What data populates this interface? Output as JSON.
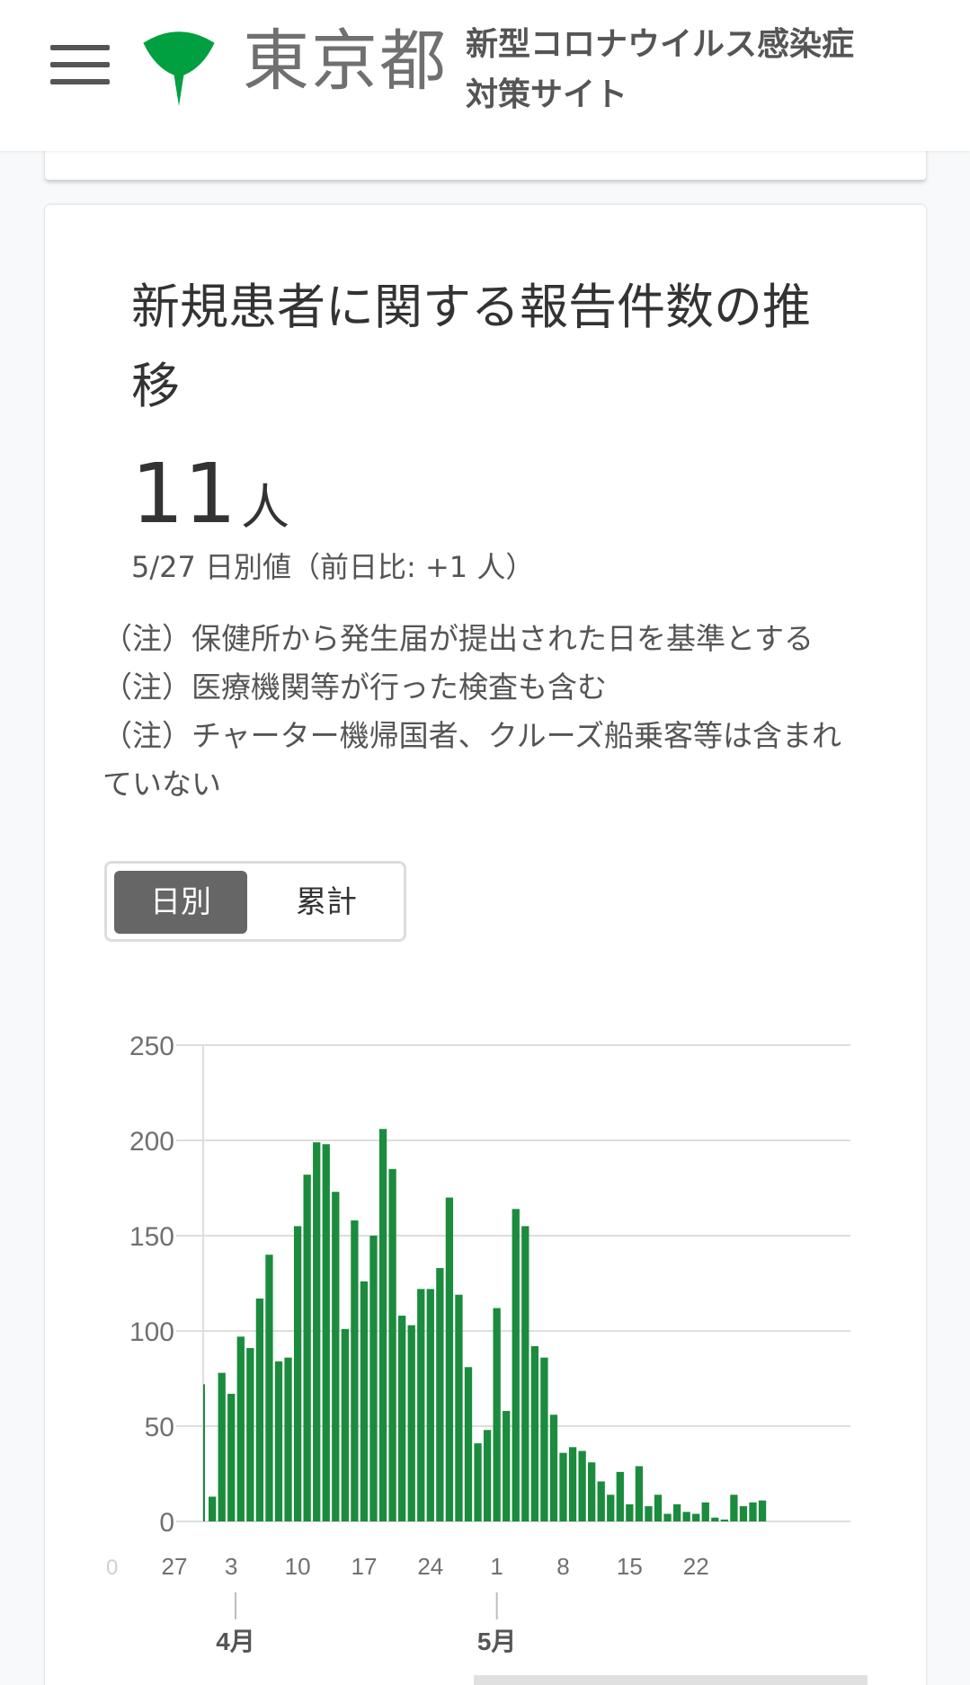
{
  "header": {
    "org_name": "東京都",
    "site_title_line1": "新型コロナウイルス感染症",
    "site_title_line2": "対策サイト"
  },
  "card": {
    "title": "新規患者に関する報告件数の推移",
    "value": "11",
    "unit": "人",
    "sub_value": "5/27 日別値（前日比: +1 人）",
    "notes": [
      "（注）保健所から発生届が提出された日を基準とする",
      "（注）医療機関等が行った検査も含む",
      "（注）チャーター機帰国者、クルーズ船乗客等は含まれていない"
    ],
    "toggle": {
      "daily": "日別",
      "cumulative": "累計",
      "selected": "日別"
    }
  },
  "colors": {
    "bar": "#1b8c3d",
    "logo": "#00a040",
    "selected_toggle": "#666666"
  },
  "chart_data": {
    "type": "bar",
    "x": [
      "3/31",
      "4/1",
      "4/2",
      "4/3",
      "4/4",
      "4/5",
      "4/6",
      "4/7",
      "4/8",
      "4/9",
      "4/10",
      "4/11",
      "4/12",
      "4/13",
      "4/14",
      "4/15",
      "4/16",
      "4/17",
      "4/18",
      "4/19",
      "4/20",
      "4/21",
      "4/22",
      "4/23",
      "4/24",
      "4/25",
      "4/26",
      "4/27",
      "4/28",
      "4/29",
      "4/30",
      "5/1",
      "5/2",
      "5/3",
      "5/4",
      "5/5",
      "5/6",
      "5/7",
      "5/8",
      "5/9",
      "5/10",
      "5/11",
      "5/12",
      "5/13",
      "5/14",
      "5/15",
      "5/16",
      "5/17",
      "5/18",
      "5/19",
      "5/20",
      "5/21",
      "5/22",
      "5/23",
      "5/24",
      "5/25",
      "5/26",
      "5/27"
    ],
    "values": [
      13,
      78,
      67,
      97,
      91,
      117,
      140,
      84,
      86,
      155,
      182,
      199,
      198,
      173,
      101,
      158,
      126,
      150,
      206,
      185,
      108,
      103,
      122,
      122,
      133,
      170,
      119,
      81,
      41,
      48,
      112,
      58,
      164,
      155,
      92,
      86,
      56,
      36,
      39,
      37,
      31,
      21,
      14,
      26,
      9,
      29,
      8,
      14,
      4,
      9,
      5,
      4,
      10,
      2,
      1,
      14,
      8,
      10,
      11
    ],
    "series_name": "",
    "ylim": [
      0,
      250
    ],
    "yticks": [
      0,
      50,
      100,
      150,
      200,
      250
    ],
    "xtick_labels": [
      "27",
      "3",
      "10",
      "17",
      "24",
      "1",
      "8",
      "15",
      "22"
    ],
    "xtick_dates": [
      "3/27",
      "4/3",
      "4/10",
      "4/17",
      "4/24",
      "5/1",
      "5/8",
      "5/15",
      "5/22"
    ],
    "month_labels": [
      {
        "label": "4月",
        "date": "4/1"
      },
      {
        "label": "5月",
        "date": "5/1"
      }
    ],
    "partial_bar": {
      "date": "3/30",
      "value": 72
    },
    "grid": true,
    "xlabel": "",
    "ylabel": ""
  }
}
